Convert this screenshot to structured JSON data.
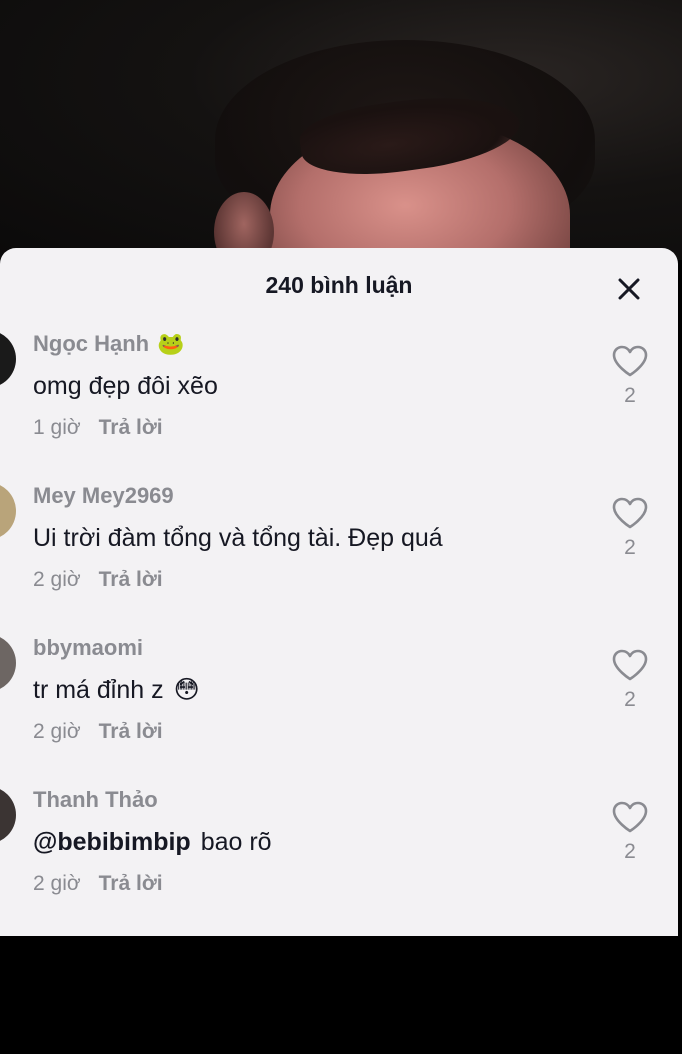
{
  "header": {
    "title": "240 bình luận",
    "close_icon": "close-icon"
  },
  "comments": [
    {
      "username": "Ngọc Hạnh",
      "username_emoji": "🐸",
      "mention": "",
      "text": "omg đẹp đôi xẽo",
      "text_emoji": "",
      "time": "1 giờ",
      "reply_label": "Trả lời",
      "likes": "2",
      "avatar_color": "#1a1a1a"
    },
    {
      "username": "Mey Mey2969",
      "username_emoji": "",
      "mention": "",
      "text": "Ui trời đàm tổng và tổng tài. Đẹp quá",
      "text_emoji": "",
      "time": "2 giờ",
      "reply_label": "Trả lời",
      "likes": "2",
      "avatar_color": "#b9a47a"
    },
    {
      "username": "bbymaomi",
      "username_emoji": "",
      "mention": "",
      "text": "tr má đỉnh z",
      "text_emoji": "😳",
      "time": "2 giờ",
      "reply_label": "Trả lời",
      "likes": "2",
      "avatar_color": "#6d6663"
    },
    {
      "username": "Thanh Thảo",
      "username_emoji": "",
      "mention": "@bebibimbip",
      "text": "bao rõ",
      "text_emoji": "",
      "time": "2 giờ",
      "reply_label": "Trả lời",
      "likes": "2",
      "avatar_color": "#3b3433"
    }
  ],
  "colors": {
    "sheet_bg": "#f3f2f4",
    "primary_text": "#161823",
    "secondary_text": "#8a8b91"
  }
}
